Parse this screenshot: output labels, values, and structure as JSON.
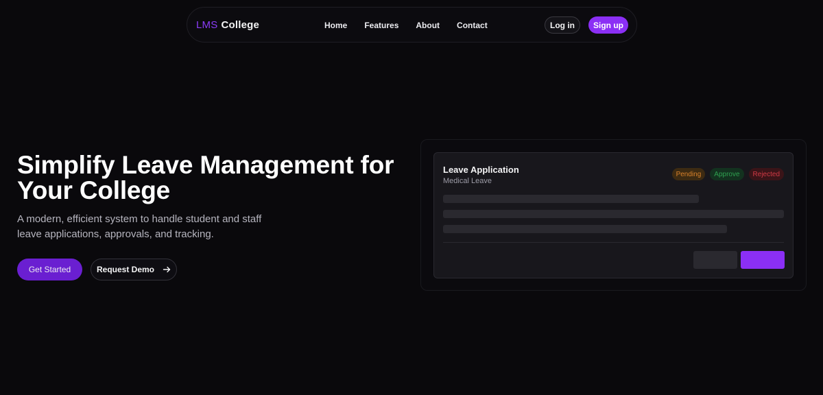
{
  "nav": {
    "brand_prefix": "LMS",
    "brand_name": "College",
    "links": [
      "Home",
      "Features",
      "About",
      "Contact"
    ],
    "login_label": "Log in",
    "signup_label": "Sign up"
  },
  "hero": {
    "title": "Simplify Leave Management for Your College",
    "subtitle": "A modern, efficient system to handle student and staff leave applications, approvals, and tracking.",
    "primary_cta": "Get Started",
    "secondary_cta": "Request Demo"
  },
  "preview": {
    "title": "Leave Application",
    "subtitle": "Medical Leave",
    "badges": [
      "Pending",
      "Approve",
      "Rejected"
    ]
  },
  "colors": {
    "accent": "#8b2ff5",
    "pending": "#d9822b",
    "approve": "#2fa150",
    "rejected": "#d23a45"
  }
}
